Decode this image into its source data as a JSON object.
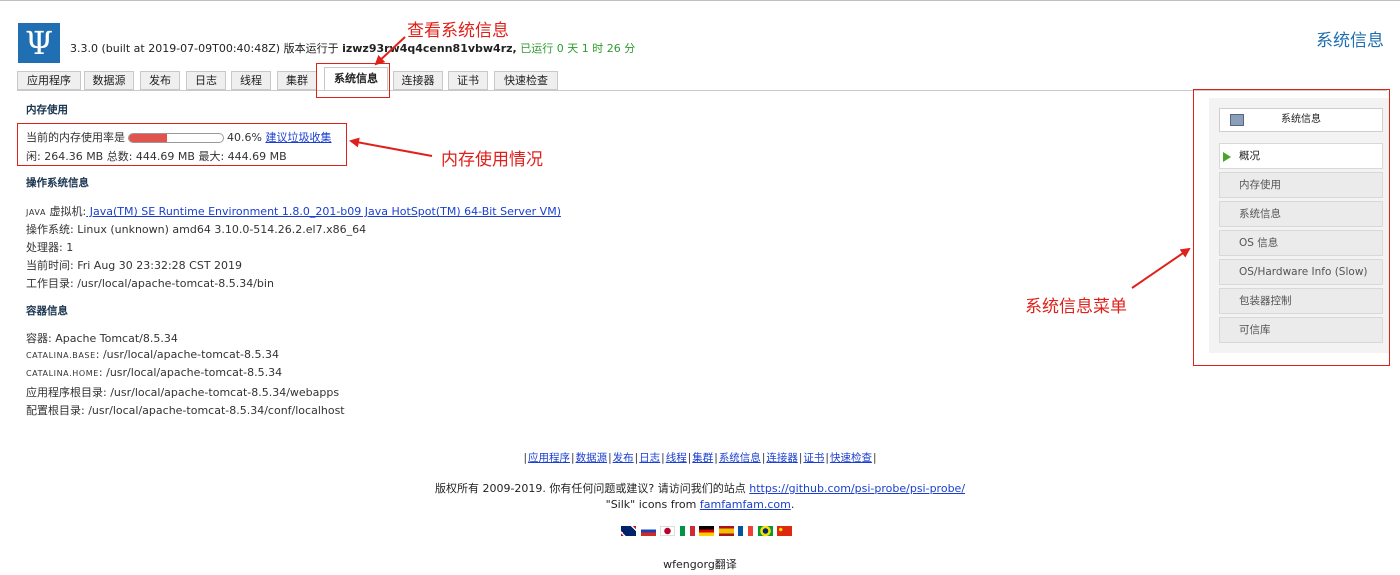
{
  "header": {
    "version_text": "3.3.0 (built at 2019-07-09T00:40:48Z) 版本运行于 ",
    "host": "izwz93rw4q4cenn81vbw4rz,",
    "uptime": " 已运行 0 天 1 时 26 分",
    "page_heading": "系统信息"
  },
  "tabs": [
    "应用程序",
    "数据源",
    "发布",
    "日志",
    "线程",
    "集群",
    "系统信息",
    "连接器",
    "证书",
    "快速检查"
  ],
  "active_tab": "系统信息",
  "memory": {
    "title": "内存使用",
    "label": "当前的内存使用率是",
    "usage_percent": 40.6,
    "usage_text": "40.6%",
    "gc_link": "建议垃圾收集",
    "details": "闲: 264.36 MB 总数: 444.69 MB 最大: 444.69 MB"
  },
  "os_info": {
    "title": "操作系统信息",
    "java_label": "JAVA",
    "java_label_suffix": " 虚拟机:",
    "java_value": " Java(TM) SE Runtime Environment  1.8.0_201-b09  Java HotSpot(TM) 64-Bit Server VM) ",
    "os": "操作系统: Linux (unknown) amd64 3.10.0-514.26.2.el7.x86_64",
    "cpus": "处理器: 1",
    "time": "当前时间: Fri Aug 30 23:32:28 CST 2019",
    "workdir": "工作目录: /usr/local/apache-tomcat-8.5.34/bin"
  },
  "container": {
    "title": "容器信息",
    "container": "容器: Apache Tomcat/8.5.34",
    "base_label": "CATALINA.BASE",
    "base_value": ": /usr/local/apache-tomcat-8.5.34",
    "home_label": "CATALINA.HOME",
    "home_value": ": /usr/local/apache-tomcat-8.5.34",
    "app_root": "应用程序根目录: /usr/local/apache-tomcat-8.5.34/webapps",
    "config_root": "配置根目录: /usr/local/apache-tomcat-8.5.34/conf/localhost"
  },
  "side_menu": {
    "header": "系统信息",
    "items": [
      "概况",
      "内存使用",
      "系统信息",
      "OS 信息",
      "OS/Hardware Info (Slow)",
      "包装器控制",
      "可信库"
    ],
    "current": "概况"
  },
  "annotations": {
    "tab": "查看系统信息",
    "memory": "内存使用情况",
    "menu": "系统信息菜单"
  },
  "footer": {
    "nav": [
      "应用程序",
      "数据源",
      "发布",
      "日志",
      "线程",
      "集群",
      "系统信息",
      "连接器",
      "证书",
      "快速检查"
    ],
    "copyright_prefix": "版权所有 2009-2019. 你有任何问题或建议? 请访问我们的站点 ",
    "site_link": "https://github.com/psi-probe/psi-probe/",
    "silk_prefix": "\"Silk\" icons from ",
    "silk_link": "famfamfam.com",
    "silk_suffix": ".",
    "translator": "wfengorg翻译",
    "flag_icons": [
      "uk-flag-icon",
      "russia-flag-icon",
      "japan-flag-icon",
      "italy-flag-icon",
      "germany-flag-icon",
      "spain-flag-icon",
      "france-flag-icon",
      "brazil-flag-icon",
      "china-flag-icon"
    ]
  },
  "colors": {
    "accent": "#1f6fb2",
    "annotation_red": "#e0201a",
    "uptime_green": "#2e9a2e",
    "memory_bar": "#e0534f"
  }
}
